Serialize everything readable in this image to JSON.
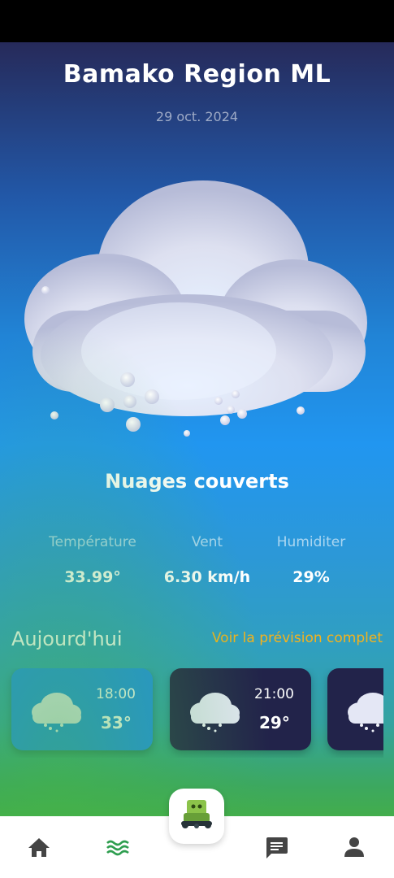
{
  "header": {
    "city": "Bamako Region ML",
    "date": "29 oct. 2024"
  },
  "current": {
    "condition": "Nuages couverts",
    "icon": "snow-cloud-icon"
  },
  "stats": [
    {
      "label": "Température",
      "value": "33.99°"
    },
    {
      "label": "Vent",
      "value": "6.30 km/h"
    },
    {
      "label": "Humiditer",
      "value": "29%"
    }
  ],
  "today": {
    "title": "Aujourd'hui",
    "link": "Voir la prévision complet",
    "hours": [
      {
        "time": "18:00",
        "temp": "33°"
      },
      {
        "time": "21:00",
        "temp": "29°"
      },
      {
        "time": "",
        "temp": ""
      }
    ]
  },
  "nav": {
    "items": [
      "home-icon",
      "waves-icon",
      "robot-icon",
      "chat-icon",
      "profile-icon"
    ],
    "active": "waves-icon"
  },
  "colors": {
    "accent": "#f6b21b",
    "active_card": "#1f8ee8",
    "dark_card": "#22234a",
    "nav_active": "#2e9e4f",
    "nav_icon": "#444444"
  }
}
